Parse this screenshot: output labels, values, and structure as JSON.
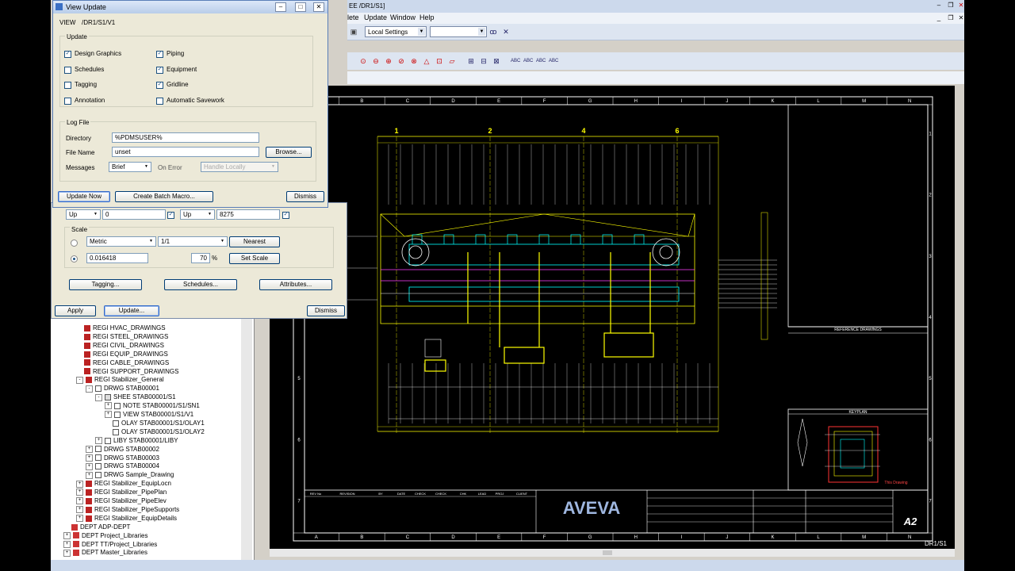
{
  "app": {
    "title_fragment": "EE /DR1/S1]",
    "menu": [
      "lete",
      "Update",
      "Window",
      "Help"
    ],
    "local_settings": "Local Settings",
    "status_left": "",
    "sheet_label": "DR1/S1"
  },
  "dialog": {
    "title": "View Update",
    "view_label": "VIEW",
    "view_path": "/DR1/S1/V1",
    "update_group": "Update",
    "checks": [
      {
        "label": "Design Graphics",
        "checked": true
      },
      {
        "label": "Schedules",
        "checked": false
      },
      {
        "label": "Tagging",
        "checked": false
      },
      {
        "label": "Annotation",
        "checked": false
      },
      {
        "label": "Piping",
        "checked": true
      },
      {
        "label": "Equipment",
        "checked": true
      },
      {
        "label": "Gridline",
        "checked": true
      },
      {
        "label": "Automatic Savework",
        "checked": false
      }
    ],
    "logfile_group": "Log File",
    "directory_label": "Directory",
    "directory_value": "%PDMSUSER%",
    "filename_label": "File Name",
    "filename_value": "unset",
    "browse_btn": "Browse...",
    "messages_label": "Messages",
    "messages_value": "Brief",
    "onerror_label": "On Error",
    "onerror_value": "Handle Locally",
    "update_now_btn": "Update Now",
    "batch_btn": "Create Batch Macro...",
    "dismiss_btn": "Dismiss"
  },
  "lower_dialog": {
    "up1_sel": "Up",
    "up1_val": "0",
    "up2_sel": "Up",
    "up2_val": "8275",
    "scale_group": "Scale",
    "scale_units": "Metric",
    "scale_ratio": "1/1",
    "nearest_btn": "Nearest",
    "scale_value": "0.016418",
    "scale_pct": "70",
    "pct_sign": "%",
    "set_scale_btn": "Set Scale",
    "tagging_btn": "Tagging...",
    "schedules_btn": "Schedules...",
    "attributes_btn": "Attributes...",
    "apply_btn": "Apply",
    "update_btn": "Update...",
    "dismiss_btn": "Dismiss"
  },
  "tree": [
    {
      "indent": 0,
      "icon": "regi",
      "exp": "",
      "label": "REGI HVAC_DRAWINGS"
    },
    {
      "indent": 0,
      "icon": "regi",
      "exp": "",
      "label": "REGI STEEL_DRAWINGS"
    },
    {
      "indent": 0,
      "icon": "regi",
      "exp": "",
      "label": "REGI CIVIL_DRAWINGS"
    },
    {
      "indent": 0,
      "icon": "regi",
      "exp": "",
      "label": "REGI EQUIP_DRAWINGS"
    },
    {
      "indent": 0,
      "icon": "regi",
      "exp": "",
      "label": "REGI CABLE_DRAWINGS"
    },
    {
      "indent": 0,
      "icon": "regi",
      "exp": "",
      "label": "REGI SUPPORT_DRAWINGS"
    },
    {
      "indent": 0,
      "icon": "regi",
      "exp": "-",
      "label": "REGI Stabilizer_General"
    },
    {
      "indent": 1,
      "icon": "drwg",
      "exp": "-",
      "label": "DRWG STAB00001"
    },
    {
      "indent": 2,
      "icon": "shee",
      "exp": "-",
      "label": "SHEE STAB00001/S1"
    },
    {
      "indent": 3,
      "icon": "drwg",
      "exp": "+",
      "label": "NOTE STAB00001/S1/SN1"
    },
    {
      "indent": 3,
      "icon": "drwg",
      "exp": "+",
      "label": "VIEW STAB00001/S1/V1"
    },
    {
      "indent": 3,
      "icon": "drwg",
      "exp": "",
      "label": "OLAY STAB00001/S1/OLAY1"
    },
    {
      "indent": 3,
      "icon": "drwg",
      "exp": "",
      "label": "OLAY STAB00001/S1/OLAY2"
    },
    {
      "indent": 2,
      "icon": "drwg",
      "exp": "+",
      "label": "LIBY STAB00001/LIBY"
    },
    {
      "indent": 1,
      "icon": "drwg",
      "exp": "+",
      "label": "DRWG STAB00002"
    },
    {
      "indent": 1,
      "icon": "drwg",
      "exp": "+",
      "label": "DRWG STAB00003"
    },
    {
      "indent": 1,
      "icon": "drwg",
      "exp": "+",
      "label": "DRWG STAB00004"
    },
    {
      "indent": 1,
      "icon": "drwg",
      "exp": "+",
      "label": "DRWG Sample_Drawing"
    },
    {
      "indent": 0,
      "icon": "regi",
      "exp": "+",
      "label": "REGI Stabilizer_EquipLocn"
    },
    {
      "indent": 0,
      "icon": "regi",
      "exp": "+",
      "label": "REGI Stabilizer_PipePlan"
    },
    {
      "indent": 0,
      "icon": "regi",
      "exp": "+",
      "label": "REGI Stabilizer_PipeElev"
    },
    {
      "indent": 0,
      "icon": "regi",
      "exp": "+",
      "label": "REGI Stabilizer_PipeSupports"
    },
    {
      "indent": 0,
      "icon": "regi",
      "exp": "+",
      "label": "REGI Stabilizer_EquipDetails"
    },
    {
      "indent": -1,
      "icon": "dept",
      "exp": "",
      "label": "DEPT ADP-DEPT"
    },
    {
      "indent": -1,
      "icon": "dept",
      "exp": "+",
      "label": "DEPT Project_Libraries"
    },
    {
      "indent": -1,
      "icon": "dept",
      "exp": "+",
      "label": "DEPT TT/Project_Libraries"
    },
    {
      "indent": -1,
      "icon": "dept",
      "exp": "+",
      "label": "DEPT Master_Libraries"
    }
  ],
  "drawing": {
    "col_letters": [
      "A",
      "B",
      "C",
      "D",
      "E",
      "F",
      "G",
      "H",
      "I",
      "J",
      "K",
      "L",
      "M",
      "N"
    ],
    "row_numbers": [
      "1",
      "2",
      "3",
      "4",
      "5",
      "6",
      "7"
    ],
    "grid_markers": [
      "1",
      "2",
      "4",
      "6"
    ],
    "reference_drawings": "REFERENCE DRAWINGS",
    "keyplan": "KEYPLAN",
    "this_drawing": "This Drawing",
    "logo": "AVEVA",
    "sheet_size": "A2",
    "rev_headers": [
      "REV No",
      "REVISION",
      "BY",
      "DATE",
      "CHECK",
      "CHECK",
      "CHK",
      "LEAD",
      "PROJ",
      "CLIENT"
    ],
    "colors": {
      "yellow": "#ffff00",
      "cyan": "#00ffff",
      "magenta": "#ff40ff",
      "white": "#ffffff",
      "green": "#44ff44"
    }
  }
}
